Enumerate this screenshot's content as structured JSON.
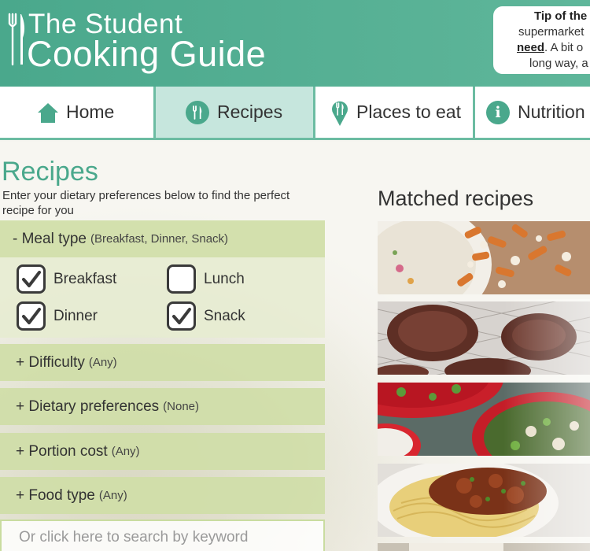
{
  "brand": {
    "title_line1": "The Student",
    "title_line2": "Cooking Guide"
  },
  "tip": {
    "line1": "Tip of the",
    "line2": "supermarket",
    "line3_link": "need",
    "line3_rest": ". A bit o",
    "line4": "long way, a"
  },
  "nav": {
    "items": [
      {
        "label": "Home",
        "icon": "house-icon"
      },
      {
        "label": "Recipes",
        "icon": "fork-knife-icon",
        "active": true
      },
      {
        "label": "Places to eat",
        "icon": "map-pin-fork-icon"
      },
      {
        "label": "Nutrition",
        "icon": "info-icon"
      }
    ],
    "info_glyph": "i"
  },
  "page": {
    "title": "Recipes",
    "intro": "Enter your dietary preferences below to find the perfect recipe for you"
  },
  "filters": {
    "meal": {
      "label": "- Meal type",
      "hint": "(Breakfast, Dinner, Snack)",
      "options": [
        {
          "label": "Breakfast",
          "checked": true
        },
        {
          "label": "Lunch",
          "checked": false
        },
        {
          "label": "Dinner",
          "checked": true
        },
        {
          "label": "Snack",
          "checked": true
        }
      ]
    },
    "difficulty": {
      "label": "+ Difficulty",
      "hint": "(Any)"
    },
    "dietary": {
      "label": "+ Dietary preferences",
      "hint": "(None)"
    },
    "cost": {
      "label": "+ Portion cost",
      "hint": "(Any)"
    },
    "food": {
      "label": "+ Food type",
      "hint": "(Any)"
    }
  },
  "search": {
    "placeholder": "Or click here to search by keyword"
  },
  "results": {
    "title": "Matched recipes"
  },
  "colors": {
    "brand_green": "#4aa88c",
    "nav_active": "#c6e6dd",
    "filter_bar": "#d0dea8"
  }
}
